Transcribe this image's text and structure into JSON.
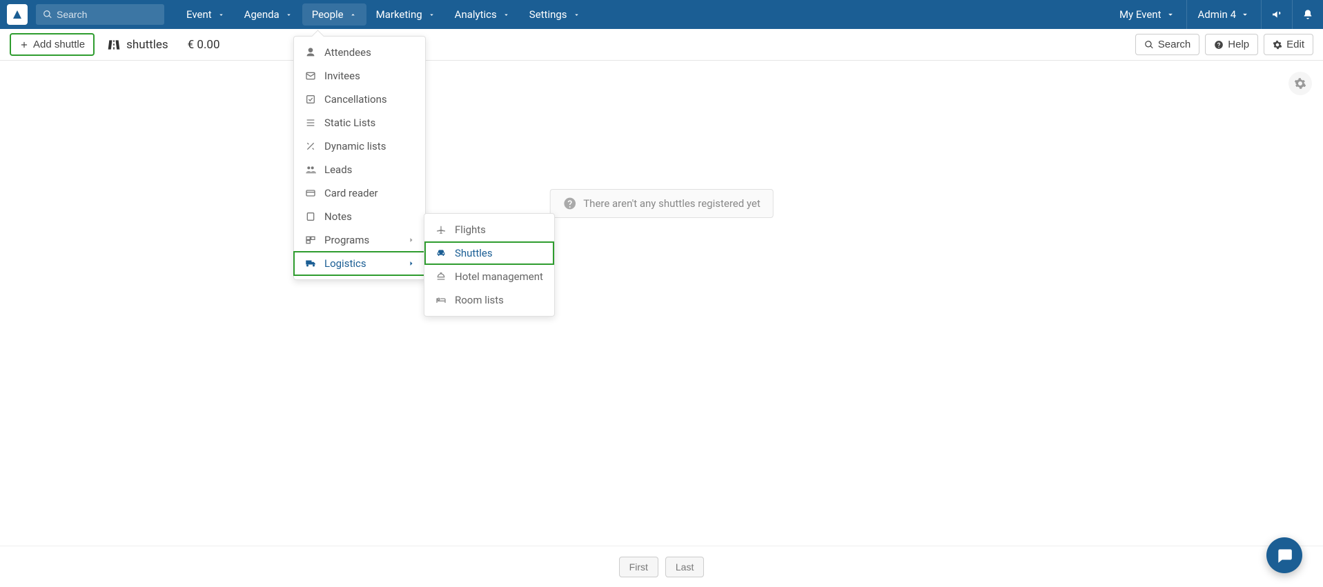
{
  "topnav": {
    "search_placeholder": "Search",
    "items": [
      "Event",
      "Agenda",
      "People",
      "Marketing",
      "Analytics",
      "Settings"
    ],
    "event_label": "My Event",
    "admin_label": "Admin 4"
  },
  "toolbar": {
    "add_label": "Add shuttle",
    "page_label": "shuttles",
    "price": "€ 0.00",
    "search_label": "Search",
    "help_label": "Help",
    "edit_label": "Edit"
  },
  "people_menu": {
    "items": [
      {
        "label": "Attendees",
        "icon": "person-icon"
      },
      {
        "label": "Invitees",
        "icon": "mail-icon"
      },
      {
        "label": "Cancellations",
        "icon": "cancel-icon"
      },
      {
        "label": "Static Lists",
        "icon": "list-icon"
      },
      {
        "label": "Dynamic lists",
        "icon": "wand-icon"
      },
      {
        "label": "Leads",
        "icon": "group-icon"
      },
      {
        "label": "Card reader",
        "icon": "card-icon"
      },
      {
        "label": "Notes",
        "icon": "note-icon"
      },
      {
        "label": "Programs",
        "icon": "programs-icon",
        "submenu": true
      },
      {
        "label": "Logistics",
        "icon": "truck-icon",
        "submenu": true,
        "active": true
      }
    ]
  },
  "logistics_submenu": {
    "items": [
      {
        "label": "Flights",
        "icon": "plane-icon"
      },
      {
        "label": "Shuttles",
        "icon": "car-icon",
        "active": true
      },
      {
        "label": "Hotel management",
        "icon": "bell-icon"
      },
      {
        "label": "Room lists",
        "icon": "bed-icon"
      }
    ]
  },
  "empty_state": "There aren't any shuttles registered yet",
  "pagination": {
    "first": "First",
    "last": "Last"
  }
}
